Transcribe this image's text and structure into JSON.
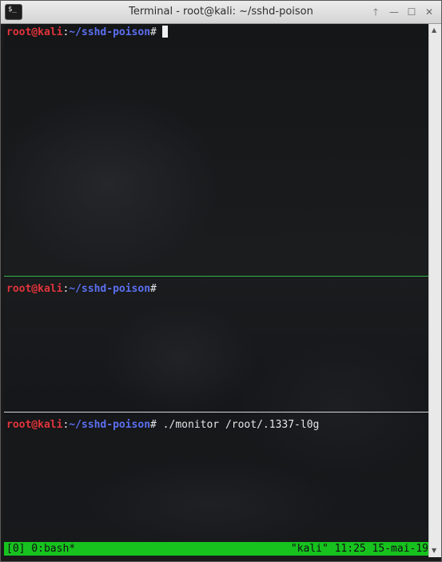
{
  "window": {
    "title": "Terminal - root@kali: ~/sshd-poison",
    "icon": "terminal-icon",
    "icon_glyph": "$_",
    "buttons": {
      "shade": "🡑",
      "minimize": "—",
      "maximize": "☐",
      "close": "✕"
    }
  },
  "panes": [
    {
      "prompt": {
        "user": "root@kali",
        "colon": ":",
        "path": "~/sshd-poison",
        "symbol": "#"
      },
      "command": "",
      "has_cursor": true
    },
    {
      "prompt": {
        "user": "root@kali",
        "colon": ":",
        "path": "~/sshd-poison",
        "symbol": "#"
      },
      "command": ""
    },
    {
      "prompt": {
        "user": "root@kali",
        "colon": ":",
        "path": "~/sshd-poison",
        "symbol": "#"
      },
      "command": " ./monitor /root/.1337-l0g"
    }
  ],
  "statusbar": {
    "left": "[0] 0:bash*",
    "right": "\"kali\" 11:25 15-mai-19"
  },
  "colors": {
    "user": "#e0343a",
    "path": "#5c6ff0",
    "status_bg": "#17c21f",
    "active_separator": "#36b34a"
  }
}
